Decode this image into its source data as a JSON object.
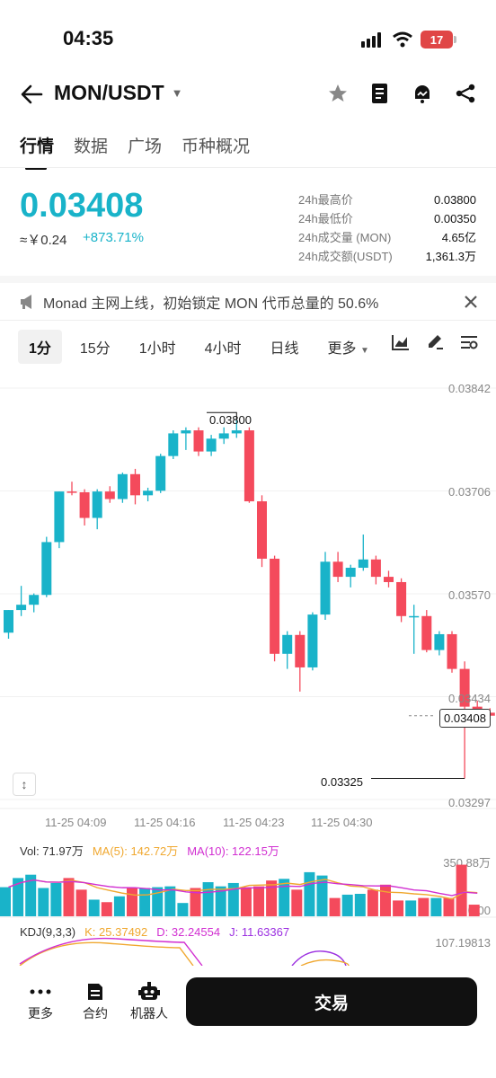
{
  "status_bar": {
    "time": "04:35",
    "battery": "17"
  },
  "header": {
    "pair": "MON/USDT"
  },
  "tabs": [
    {
      "label": "行情",
      "active": true
    },
    {
      "label": "数据",
      "active": false
    },
    {
      "label": "广场",
      "active": false
    },
    {
      "label": "币种概况",
      "active": false
    }
  ],
  "ticker": {
    "price": "0.03408",
    "cny": "≈￥0.24",
    "change": "+873.71%",
    "stats": [
      {
        "label": "24h最高价",
        "value": "0.03800"
      },
      {
        "label": "24h最低价",
        "value": "0.00350"
      },
      {
        "label": "24h成交量 (MON)",
        "value": "4.65亿"
      },
      {
        "label": "24h成交额(USDT)",
        "value": "1,361.3万"
      }
    ]
  },
  "announcement": {
    "text": "Monad 主网上线，初始锁定 MON 代币总量的 50.6%"
  },
  "intervals": [
    "1分",
    "15分",
    "1小时",
    "4小时",
    "日线",
    "更多"
  ],
  "active_interval": "1分",
  "chart": {
    "y_ticks": [
      "0.03842",
      "0.03706",
      "0.03570",
      "0.03434",
      "0.03297"
    ],
    "x_ticks": [
      "11-25 04:09",
      "11-25 04:16",
      "11-25 04:23",
      "11-25 04:30"
    ],
    "last_price": "0.03408",
    "high_label": "0.03800",
    "low_label": "0.03325"
  },
  "volume": {
    "vol": "Vol: 71.97万",
    "ma5": "MA(5): 142.72万",
    "ma10": "MA(10): 122.15万",
    "max": "350.88万",
    "zero": "0.00"
  },
  "kdj": {
    "title": "KDJ(9,3,3)",
    "k": "K: 25.37492",
    "d": "D: 32.24554",
    "j": "J: 11.63367",
    "max": "107.19813"
  },
  "bottom_nav": [
    {
      "label": "更多",
      "icon": "more-icon"
    },
    {
      "label": "合约",
      "icon": "contract-icon"
    },
    {
      "label": "机器人",
      "icon": "robot-icon"
    }
  ],
  "trade_button": "交易",
  "colors": {
    "up": "#19b3c9",
    "down": "#f44a5c",
    "ma5": "#f0a830",
    "ma10": "#d12fd1"
  },
  "chart_data": {
    "type": "candlestick",
    "x_ticks": [
      "11-25 04:09",
      "11-25 04:16",
      "11-25 04:23",
      "11-25 04:30"
    ],
    "ylim": [
      0.03297,
      0.03842
    ],
    "candles": [
      {
        "o": 0.03518,
        "h": 0.03548,
        "l": 0.0351,
        "c": 0.03548
      },
      {
        "o": 0.03548,
        "h": 0.0358,
        "l": 0.0354,
        "c": 0.03555
      },
      {
        "o": 0.03555,
        "h": 0.0357,
        "l": 0.03545,
        "c": 0.03568
      },
      {
        "o": 0.03568,
        "h": 0.03645,
        "l": 0.03565,
        "c": 0.03638
      },
      {
        "o": 0.03638,
        "h": 0.03705,
        "l": 0.0363,
        "c": 0.03705
      },
      {
        "o": 0.03705,
        "h": 0.03718,
        "l": 0.037,
        "c": 0.03704
      },
      {
        "o": 0.03704,
        "h": 0.03708,
        "l": 0.0366,
        "c": 0.0367
      },
      {
        "o": 0.0367,
        "h": 0.03708,
        "l": 0.03655,
        "c": 0.03705
      },
      {
        "o": 0.03705,
        "h": 0.03712,
        "l": 0.0369,
        "c": 0.03695
      },
      {
        "o": 0.03695,
        "h": 0.0373,
        "l": 0.0369,
        "c": 0.03728
      },
      {
        "o": 0.03728,
        "h": 0.03735,
        "l": 0.03688,
        "c": 0.037
      },
      {
        "o": 0.037,
        "h": 0.0371,
        "l": 0.03692,
        "c": 0.03706
      },
      {
        "o": 0.03706,
        "h": 0.03755,
        "l": 0.03703,
        "c": 0.03752
      },
      {
        "o": 0.03752,
        "h": 0.03786,
        "l": 0.03748,
        "c": 0.03782
      },
      {
        "o": 0.03782,
        "h": 0.0379,
        "l": 0.0376,
        "c": 0.03786
      },
      {
        "o": 0.03786,
        "h": 0.0379,
        "l": 0.03752,
        "c": 0.03758
      },
      {
        "o": 0.03758,
        "h": 0.0378,
        "l": 0.03752,
        "c": 0.03775
      },
      {
        "o": 0.03775,
        "h": 0.0379,
        "l": 0.03768,
        "c": 0.03782
      },
      {
        "o": 0.03782,
        "h": 0.038,
        "l": 0.03776,
        "c": 0.03786
      },
      {
        "o": 0.03786,
        "h": 0.0379,
        "l": 0.0369,
        "c": 0.03692
      },
      {
        "o": 0.03692,
        "h": 0.037,
        "l": 0.03605,
        "c": 0.03616
      },
      {
        "o": 0.03616,
        "h": 0.0362,
        "l": 0.0348,
        "c": 0.0349
      },
      {
        "o": 0.0349,
        "h": 0.0352,
        "l": 0.0347,
        "c": 0.03515
      },
      {
        "o": 0.03515,
        "h": 0.0352,
        "l": 0.0344,
        "c": 0.03472
      },
      {
        "o": 0.03472,
        "h": 0.03545,
        "l": 0.03468,
        "c": 0.03542
      },
      {
        "o": 0.03542,
        "h": 0.03625,
        "l": 0.03535,
        "c": 0.03612
      },
      {
        "o": 0.03612,
        "h": 0.03625,
        "l": 0.03585,
        "c": 0.03592
      },
      {
        "o": 0.03592,
        "h": 0.03608,
        "l": 0.03578,
        "c": 0.03604
      },
      {
        "o": 0.03604,
        "h": 0.03648,
        "l": 0.036,
        "c": 0.03615
      },
      {
        "o": 0.03615,
        "h": 0.0362,
        "l": 0.03582,
        "c": 0.03592
      },
      {
        "o": 0.03592,
        "h": 0.036,
        "l": 0.03578,
        "c": 0.03585
      },
      {
        "o": 0.03585,
        "h": 0.0359,
        "l": 0.03532,
        "c": 0.0354
      },
      {
        "o": 0.0354,
        "h": 0.03555,
        "l": 0.0349,
        "c": 0.0354
      },
      {
        "o": 0.0354,
        "h": 0.03548,
        "l": 0.03492,
        "c": 0.03495
      },
      {
        "o": 0.03495,
        "h": 0.0352,
        "l": 0.03488,
        "c": 0.03516
      },
      {
        "o": 0.03516,
        "h": 0.0352,
        "l": 0.03465,
        "c": 0.0347
      },
      {
        "o": 0.0347,
        "h": 0.0348,
        "l": 0.03325,
        "c": 0.0342
      },
      {
        "o": 0.0342,
        "h": 0.03428,
        "l": 0.03405,
        "c": 0.03412
      },
      {
        "o": 0.03412,
        "h": 0.03418,
        "l": 0.03404,
        "c": 0.03408
      }
    ],
    "volume": [
      175,
      230,
      250,
      170,
      200,
      230,
      160,
      100,
      85,
      120,
      170,
      170,
      175,
      180,
      80,
      170,
      205,
      180,
      200,
      175,
      180,
      215,
      225,
      160,
      265,
      245,
      110,
      130,
      135,
      160,
      190,
      95,
      95,
      110,
      110,
      110,
      310,
      70
    ],
    "volume_max": 350.88
  }
}
